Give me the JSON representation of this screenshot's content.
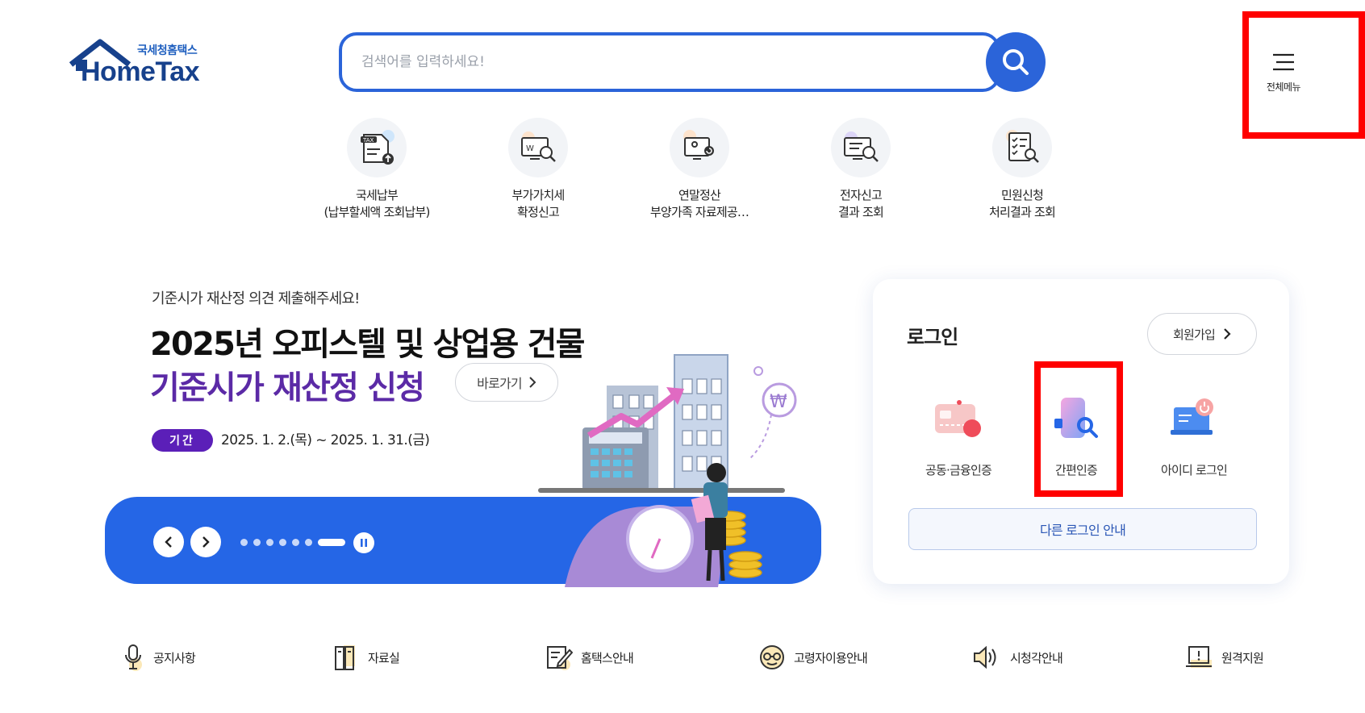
{
  "header": {
    "logo_sub": "국세청홈택스",
    "logo_main": "HomeTax",
    "search_placeholder": "검색어를 입력하세요!",
    "menu_label": "전체메뉴"
  },
  "quick_menu": [
    {
      "label": "국세납부\n(납부할세액 조회납부)",
      "icon": "tax-payment-icon"
    },
    {
      "label": "부가가치세\n확정신고",
      "icon": "vat-report-icon"
    },
    {
      "label": "연말정산\n부양가족 자료제공…",
      "icon": "year-end-settlement-icon"
    },
    {
      "label": "전자신고\n결과 조회",
      "icon": "e-filing-result-icon"
    },
    {
      "label": "민원신청\n처리결과 조회",
      "icon": "civil-petition-icon"
    }
  ],
  "banner": {
    "subtitle": "기준시가 재산정 의견 제출해주세요!",
    "title_line1": "2025년 오피스텔 및 상업용 건물",
    "title_line2": "기준시가 재산정 신청",
    "go_label": "바로가기",
    "period_badge": "기간",
    "period_text": "2025. 1. 2.(목) ~ 2025. 1. 31.(금)"
  },
  "login": {
    "title": "로그인",
    "join_label": "회원가입",
    "options": [
      {
        "label": "공동·금융인증",
        "icon": "joint-certificate-icon"
      },
      {
        "label": "간편인증",
        "icon": "simple-auth-icon"
      },
      {
        "label": "아이디 로그인",
        "icon": "id-login-icon"
      }
    ],
    "other_login_label": "다른 로그인 안내"
  },
  "footer_links": [
    {
      "label": "공지사항",
      "icon": "microphone-icon"
    },
    {
      "label": "자료실",
      "icon": "archive-icon"
    },
    {
      "label": "홈택스안내",
      "icon": "guide-edit-icon"
    },
    {
      "label": "고령자이용안내",
      "icon": "senior-icon"
    },
    {
      "label": "시청각안내",
      "icon": "speaker-icon"
    },
    {
      "label": "원격지원",
      "icon": "remote-support-icon"
    }
  ],
  "colors": {
    "brand_blue": "#2b64d9",
    "banner_blue": "#2566e6",
    "banner_purple": "#5b2aa6",
    "highlight_red": "#ff0000"
  }
}
